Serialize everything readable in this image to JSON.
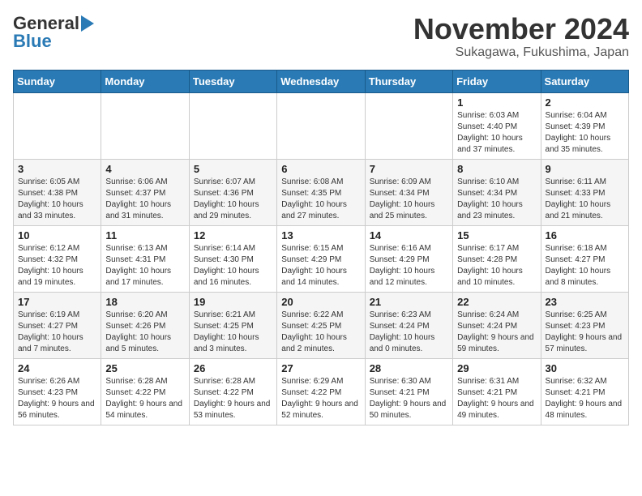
{
  "logo": {
    "line1": "General",
    "line2": "Blue"
  },
  "title": "November 2024",
  "subtitle": "Sukagawa, Fukushima, Japan",
  "days_of_week": [
    "Sunday",
    "Monday",
    "Tuesday",
    "Wednesday",
    "Thursday",
    "Friday",
    "Saturday"
  ],
  "weeks": [
    [
      {
        "day": "",
        "info": ""
      },
      {
        "day": "",
        "info": ""
      },
      {
        "day": "",
        "info": ""
      },
      {
        "day": "",
        "info": ""
      },
      {
        "day": "",
        "info": ""
      },
      {
        "day": "1",
        "info": "Sunrise: 6:03 AM\nSunset: 4:40 PM\nDaylight: 10 hours and 37 minutes."
      },
      {
        "day": "2",
        "info": "Sunrise: 6:04 AM\nSunset: 4:39 PM\nDaylight: 10 hours and 35 minutes."
      }
    ],
    [
      {
        "day": "3",
        "info": "Sunrise: 6:05 AM\nSunset: 4:38 PM\nDaylight: 10 hours and 33 minutes."
      },
      {
        "day": "4",
        "info": "Sunrise: 6:06 AM\nSunset: 4:37 PM\nDaylight: 10 hours and 31 minutes."
      },
      {
        "day": "5",
        "info": "Sunrise: 6:07 AM\nSunset: 4:36 PM\nDaylight: 10 hours and 29 minutes."
      },
      {
        "day": "6",
        "info": "Sunrise: 6:08 AM\nSunset: 4:35 PM\nDaylight: 10 hours and 27 minutes."
      },
      {
        "day": "7",
        "info": "Sunrise: 6:09 AM\nSunset: 4:34 PM\nDaylight: 10 hours and 25 minutes."
      },
      {
        "day": "8",
        "info": "Sunrise: 6:10 AM\nSunset: 4:34 PM\nDaylight: 10 hours and 23 minutes."
      },
      {
        "day": "9",
        "info": "Sunrise: 6:11 AM\nSunset: 4:33 PM\nDaylight: 10 hours and 21 minutes."
      }
    ],
    [
      {
        "day": "10",
        "info": "Sunrise: 6:12 AM\nSunset: 4:32 PM\nDaylight: 10 hours and 19 minutes."
      },
      {
        "day": "11",
        "info": "Sunrise: 6:13 AM\nSunset: 4:31 PM\nDaylight: 10 hours and 17 minutes."
      },
      {
        "day": "12",
        "info": "Sunrise: 6:14 AM\nSunset: 4:30 PM\nDaylight: 10 hours and 16 minutes."
      },
      {
        "day": "13",
        "info": "Sunrise: 6:15 AM\nSunset: 4:29 PM\nDaylight: 10 hours and 14 minutes."
      },
      {
        "day": "14",
        "info": "Sunrise: 6:16 AM\nSunset: 4:29 PM\nDaylight: 10 hours and 12 minutes."
      },
      {
        "day": "15",
        "info": "Sunrise: 6:17 AM\nSunset: 4:28 PM\nDaylight: 10 hours and 10 minutes."
      },
      {
        "day": "16",
        "info": "Sunrise: 6:18 AM\nSunset: 4:27 PM\nDaylight: 10 hours and 8 minutes."
      }
    ],
    [
      {
        "day": "17",
        "info": "Sunrise: 6:19 AM\nSunset: 4:27 PM\nDaylight: 10 hours and 7 minutes."
      },
      {
        "day": "18",
        "info": "Sunrise: 6:20 AM\nSunset: 4:26 PM\nDaylight: 10 hours and 5 minutes."
      },
      {
        "day": "19",
        "info": "Sunrise: 6:21 AM\nSunset: 4:25 PM\nDaylight: 10 hours and 3 minutes."
      },
      {
        "day": "20",
        "info": "Sunrise: 6:22 AM\nSunset: 4:25 PM\nDaylight: 10 hours and 2 minutes."
      },
      {
        "day": "21",
        "info": "Sunrise: 6:23 AM\nSunset: 4:24 PM\nDaylight: 10 hours and 0 minutes."
      },
      {
        "day": "22",
        "info": "Sunrise: 6:24 AM\nSunset: 4:24 PM\nDaylight: 9 hours and 59 minutes."
      },
      {
        "day": "23",
        "info": "Sunrise: 6:25 AM\nSunset: 4:23 PM\nDaylight: 9 hours and 57 minutes."
      }
    ],
    [
      {
        "day": "24",
        "info": "Sunrise: 6:26 AM\nSunset: 4:23 PM\nDaylight: 9 hours and 56 minutes."
      },
      {
        "day": "25",
        "info": "Sunrise: 6:28 AM\nSunset: 4:22 PM\nDaylight: 9 hours and 54 minutes."
      },
      {
        "day": "26",
        "info": "Sunrise: 6:28 AM\nSunset: 4:22 PM\nDaylight: 9 hours and 53 minutes."
      },
      {
        "day": "27",
        "info": "Sunrise: 6:29 AM\nSunset: 4:22 PM\nDaylight: 9 hours and 52 minutes."
      },
      {
        "day": "28",
        "info": "Sunrise: 6:30 AM\nSunset: 4:21 PM\nDaylight: 9 hours and 50 minutes."
      },
      {
        "day": "29",
        "info": "Sunrise: 6:31 AM\nSunset: 4:21 PM\nDaylight: 9 hours and 49 minutes."
      },
      {
        "day": "30",
        "info": "Sunrise: 6:32 AM\nSunset: 4:21 PM\nDaylight: 9 hours and 48 minutes."
      }
    ]
  ]
}
